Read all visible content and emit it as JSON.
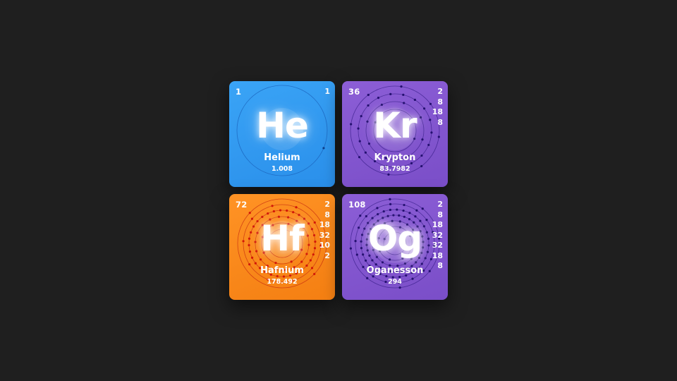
{
  "elements": [
    {
      "atomic_number": "1",
      "symbol": "He",
      "name": "Helium",
      "mass": "1.008",
      "shells": [
        "1"
      ],
      "color": "#2f97ef",
      "orbit_color": "#1a5fb8",
      "electron_color": "#0d3f8a"
    },
    {
      "atomic_number": "36",
      "symbol": "Kr",
      "name": "Krypton",
      "mass": "83.7982",
      "shells": [
        "2",
        "8",
        "18",
        "8"
      ],
      "color": "#8357cf",
      "orbit_color": "#3a1f8a",
      "electron_color": "#241070"
    },
    {
      "atomic_number": "72",
      "symbol": "Hf",
      "name": "Hafnium",
      "mass": "178.492",
      "shells": [
        "2",
        "8",
        "18",
        "32",
        "10",
        "2"
      ],
      "color": "#f8881a",
      "orbit_color": "#c62a10",
      "electron_color": "#d21808"
    },
    {
      "atomic_number": "108",
      "symbol": "Og",
      "name": "Oganesson",
      "mass": "294",
      "shells": [
        "2",
        "8",
        "18",
        "32",
        "32",
        "18",
        "8"
      ],
      "color": "#8357cf",
      "orbit_color": "#3a1f8a",
      "electron_color": "#241070"
    }
  ]
}
